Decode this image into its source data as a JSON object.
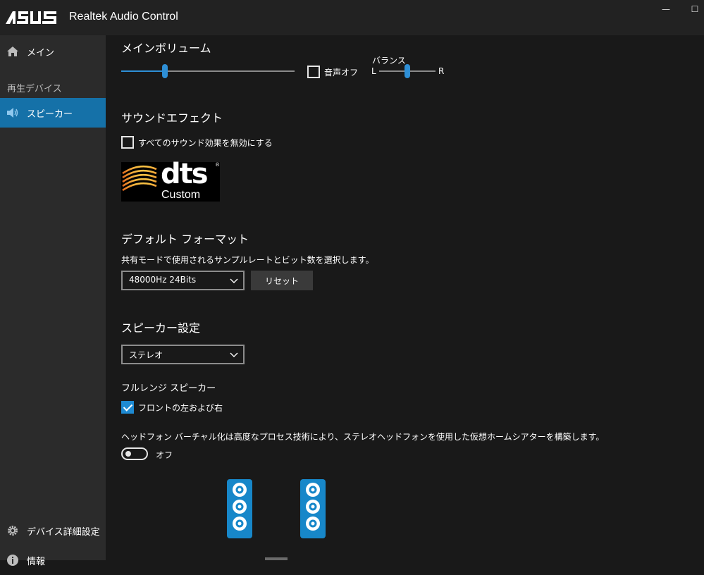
{
  "titlebar": {
    "brand": "ASUS",
    "title": "Realtek Audio Control",
    "minimize_label": "—",
    "maximize_label": "☐"
  },
  "sidebar": {
    "items": [
      {
        "label": "メイン",
        "icon": "home-icon"
      },
      {
        "label": "スピーカー",
        "icon": "speaker-icon",
        "active": true
      }
    ],
    "section_label": "再生デバイス",
    "bottom_items": [
      {
        "label": "デバイス詳細設定",
        "icon": "gear-icon"
      },
      {
        "label": "情報",
        "icon": "info-icon"
      }
    ]
  },
  "main_volume": {
    "title": "メインボリューム",
    "level": 0.25,
    "mute_label": "音声オフ",
    "mute_checked": false,
    "balance_label": "バランス",
    "balance_left": "L",
    "balance_right": "R",
    "balance": 0.5
  },
  "sound_effect": {
    "title": "サウンドエフェクト",
    "disable_all_label": "すべてのサウンド効果を無効にする",
    "disable_all_checked": false,
    "dts_brand": "dts",
    "dts_sub": "Custom"
  },
  "default_format": {
    "title": "デフォルト フォーマット",
    "description": "共有モードで使用されるサンプルレートとビット数を選択します。",
    "selected": "48000Hz 24Bits",
    "reset_label": "リセット"
  },
  "speaker_settings": {
    "title": "スピーカー設定",
    "selected": "ステレオ",
    "fullrange_title": "フルレンジ スピーカー",
    "front_lr_label": "フロントの左および右",
    "front_lr_checked": true,
    "headphone_description": "ヘッドフォン バーチャル化は高度なプロセス技術により、ステレオヘッドフォンを使用した仮想ホームシアターを構築します。",
    "headphone_toggle_label": "オフ",
    "headphone_on": false
  },
  "colors": {
    "accent": "#1e8ad2",
    "sidebar_active": "#1571a8",
    "background": "#191919",
    "sidebar_bg": "#2b2b2b"
  }
}
